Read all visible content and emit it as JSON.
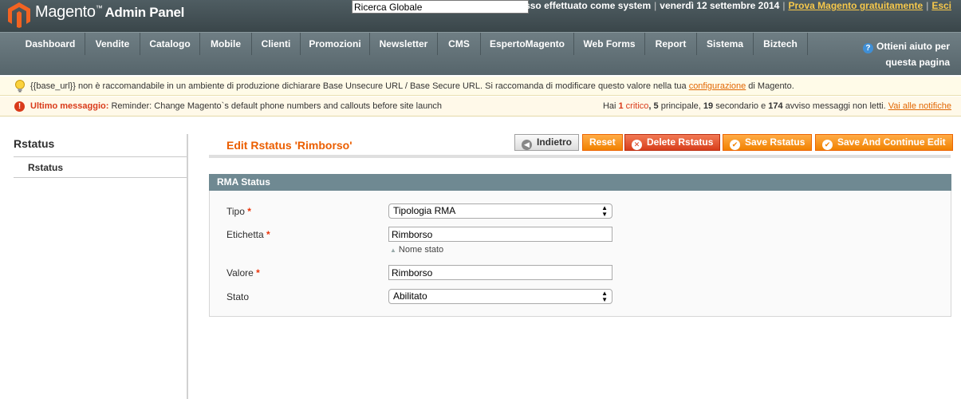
{
  "header": {
    "logo_word": "Magento",
    "logo_tm": "™",
    "logo_suffix": "Admin Panel",
    "search_value": "Ricerca Globale",
    "logged_in": "Accesso effettuato come system",
    "date": "venerdì 12 settembre 2014",
    "try_link": "Prova Magento gratuitamente",
    "logout": "Esci"
  },
  "nav": {
    "items": [
      "Dashboard",
      "Vendite",
      "Catalogo",
      "Mobile",
      "Clienti",
      "Promozioni",
      "Newsletter",
      "CMS",
      "EspertoMagento",
      "Web Forms",
      "Report",
      "Sistema",
      "Biztech"
    ],
    "help": "Ottieni aiuto per questa pagina"
  },
  "notices": {
    "base_url_text": "{{base_url}} non è raccomandabile in un ambiente di produzione dichiarare Base Unsecure URL / Base Secure URL. Si raccomanda di modificare questo valore nella tua ",
    "base_url_link": "configurazione",
    "base_url_suffix": " di Magento.",
    "last_label": "Ultimo messaggio:",
    "last_text": " Reminder: Change Magento`s default phone numbers and callouts before site launch",
    "summary_pre": "Hai ",
    "critical_count": "1",
    "critical_label": " critico",
    "major": ", 5",
    "major_label": " principale, ",
    "minor": "19",
    "minor_label": " secondario e ",
    "notice_count": "174",
    "notice_label": " avviso messaggi non letti. ",
    "all_link": "Vai alle notifiche"
  },
  "sidebar": {
    "title": "Rstatus",
    "tab": "Rstatus"
  },
  "content": {
    "title": "Edit Rstatus 'Rimborso'",
    "buttons": {
      "back": "Indietro",
      "reset": "Reset",
      "delete": "Delete Rstatus",
      "save": "Save Rstatus",
      "save_continue": "Save And Continue Edit"
    }
  },
  "form": {
    "legend": "RMA Status",
    "tipo_label": "Tipo",
    "tipo_value": "Tipologia RMA",
    "etichetta_label": "Etichetta",
    "etichetta_value": "Rimborso",
    "etichetta_hint": "Nome stato",
    "valore_label": "Valore",
    "valore_value": "Rimborso",
    "stato_label": "Stato",
    "stato_value": "Abilitato",
    "required_mark": "*"
  },
  "colors": {
    "accent_orange": "#eb5e00",
    "header_bg": "#3a464a",
    "nav_bg": "#5e6d73",
    "fieldset_head": "#6f8992"
  }
}
